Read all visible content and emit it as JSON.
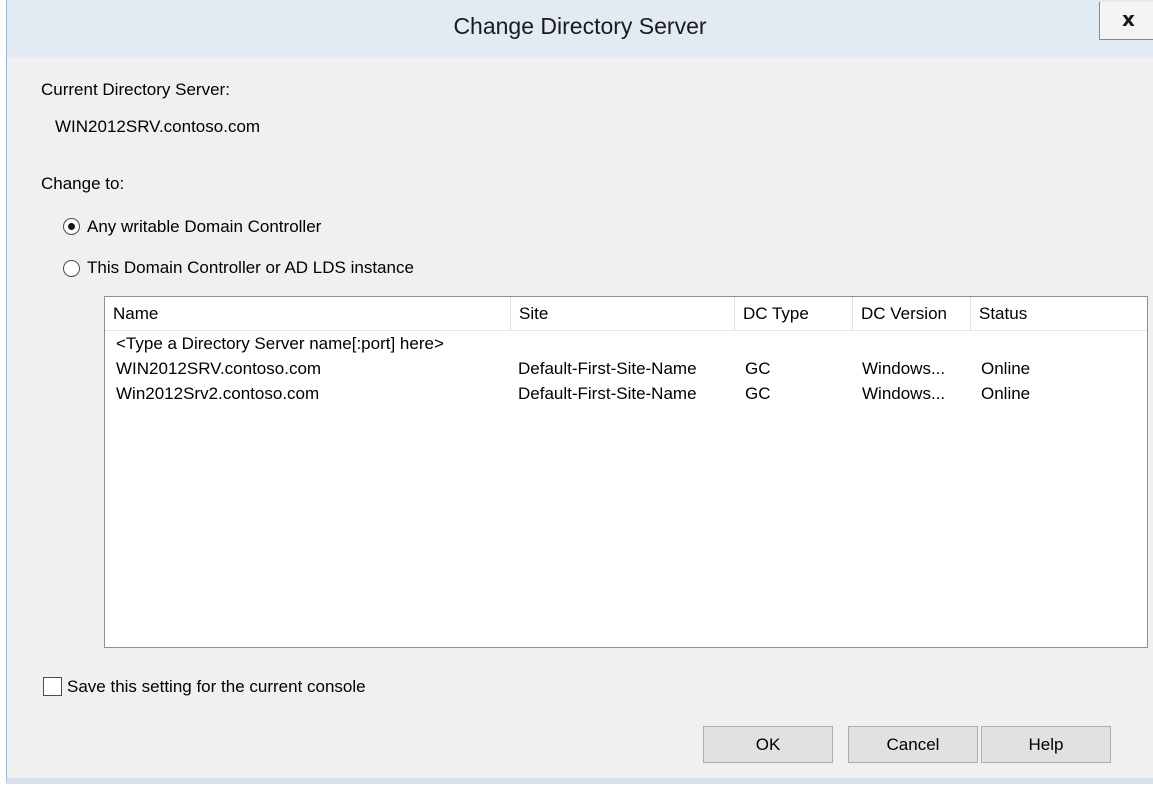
{
  "dialog": {
    "title": "Change Directory Server",
    "close_glyph": "x"
  },
  "current": {
    "label": "Current Directory Server:",
    "value": "WIN2012SRV.contoso.com"
  },
  "change_to": {
    "label": "Change to:",
    "options": [
      {
        "label": "Any writable Domain Controller",
        "selected": true
      },
      {
        "label": "This Domain Controller or AD LDS instance",
        "selected": false
      }
    ]
  },
  "server_list": {
    "columns": [
      "Name",
      "Site",
      "DC Type",
      "DC Version",
      "Status"
    ],
    "placeholder_row": "<Type a Directory Server name[:port] here>",
    "rows": [
      [
        "WIN2012SRV.contoso.com",
        "Default-First-Site-Name",
        "GC",
        "Windows...",
        "Online"
      ],
      [
        "Win2012Srv2.contoso.com",
        "Default-First-Site-Name",
        "GC",
        "Windows...",
        "Online"
      ]
    ]
  },
  "save_setting": {
    "label": "Save this setting for the current console",
    "checked": false
  },
  "buttons": {
    "ok": "OK",
    "cancel": "Cancel",
    "help": "Help"
  }
}
